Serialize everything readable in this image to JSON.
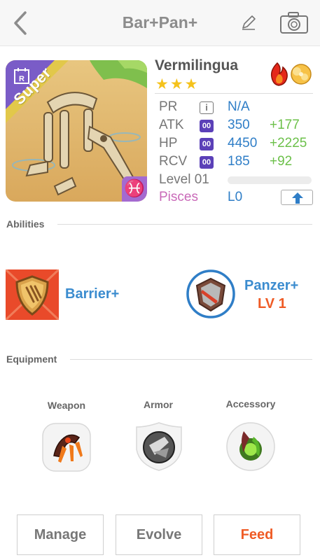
{
  "header": {
    "title": "Bar+Pan+"
  },
  "card": {
    "rarity_label": "Super",
    "rank_letter": "R",
    "zodiac_symbol": "♓"
  },
  "monster": {
    "name": "Vermilingua",
    "stars": "★★★",
    "stats": {
      "pr": {
        "label": "PR",
        "icon": "i",
        "value": "N/A"
      },
      "atk": {
        "label": "ATK",
        "icon": "00",
        "value": "350",
        "bonus": "+177"
      },
      "hp": {
        "label": "HP",
        "icon": "00",
        "value": "4450",
        "bonus": "+2225"
      },
      "rcv": {
        "label": "RCV",
        "icon": "00",
        "value": "185",
        "bonus": "+92"
      }
    },
    "level": "Level 01",
    "level_progress": 0,
    "zodiac": "Pisces",
    "zodiac_level": "L0"
  },
  "abilities": {
    "heading": "Abilities",
    "items": [
      {
        "name": "Barrier+",
        "level": ""
      },
      {
        "name": "Panzer+",
        "level": "LV 1"
      }
    ]
  },
  "equipment": {
    "heading": "Equipment",
    "slots": [
      {
        "label": "Weapon"
      },
      {
        "label": "Armor"
      },
      {
        "label": "Accessory"
      }
    ]
  },
  "actions": {
    "manage": "Manage",
    "evolve": "Evolve",
    "feed": "Feed"
  },
  "colors": {
    "accent_blue": "#3b8ccf",
    "accent_orange": "#ef5b25",
    "bonus_green": "#6cc04a",
    "pisces_pink": "#c969b8"
  }
}
